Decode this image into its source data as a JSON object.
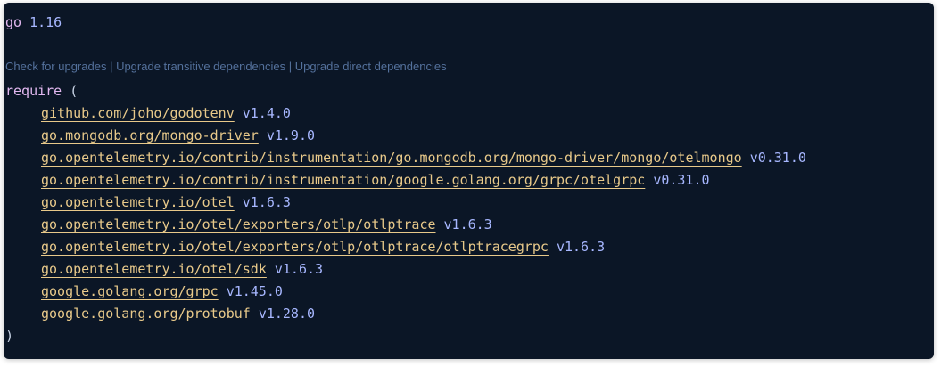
{
  "editor": {
    "go_keyword": "go",
    "go_version": "1.16",
    "codelens": {
      "check_upgrades": "Check for upgrades",
      "upgrade_transitive": "Upgrade transitive dependencies",
      "upgrade_direct": "Upgrade direct dependencies",
      "separator": " | "
    },
    "require_keyword": "require",
    "open_paren": "(",
    "close_paren": ")",
    "dependencies": [
      {
        "path": "github.com/joho/godotenv",
        "version": "v1.4.0"
      },
      {
        "path": "go.mongodb.org/mongo-driver",
        "version": "v1.9.0"
      },
      {
        "path": "go.opentelemetry.io/contrib/instrumentation/go.mongodb.org/mongo-driver/mongo/otelmongo",
        "version": "v0.31.0"
      },
      {
        "path": "go.opentelemetry.io/contrib/instrumentation/google.golang.org/grpc/otelgrpc",
        "version": "v0.31.0"
      },
      {
        "path": "go.opentelemetry.io/otel",
        "version": "v1.6.3"
      },
      {
        "path": "go.opentelemetry.io/otel/exporters/otlp/otlptrace",
        "version": "v1.6.3"
      },
      {
        "path": "go.opentelemetry.io/otel/exporters/otlp/otlptrace/otlptracegrpc",
        "version": "v1.6.3"
      },
      {
        "path": "go.opentelemetry.io/otel/sdk",
        "version": "v1.6.3"
      },
      {
        "path": "google.golang.org/grpc",
        "version": "v1.45.0"
      },
      {
        "path": "google.golang.org/protobuf",
        "version": "v1.28.0"
      }
    ]
  }
}
